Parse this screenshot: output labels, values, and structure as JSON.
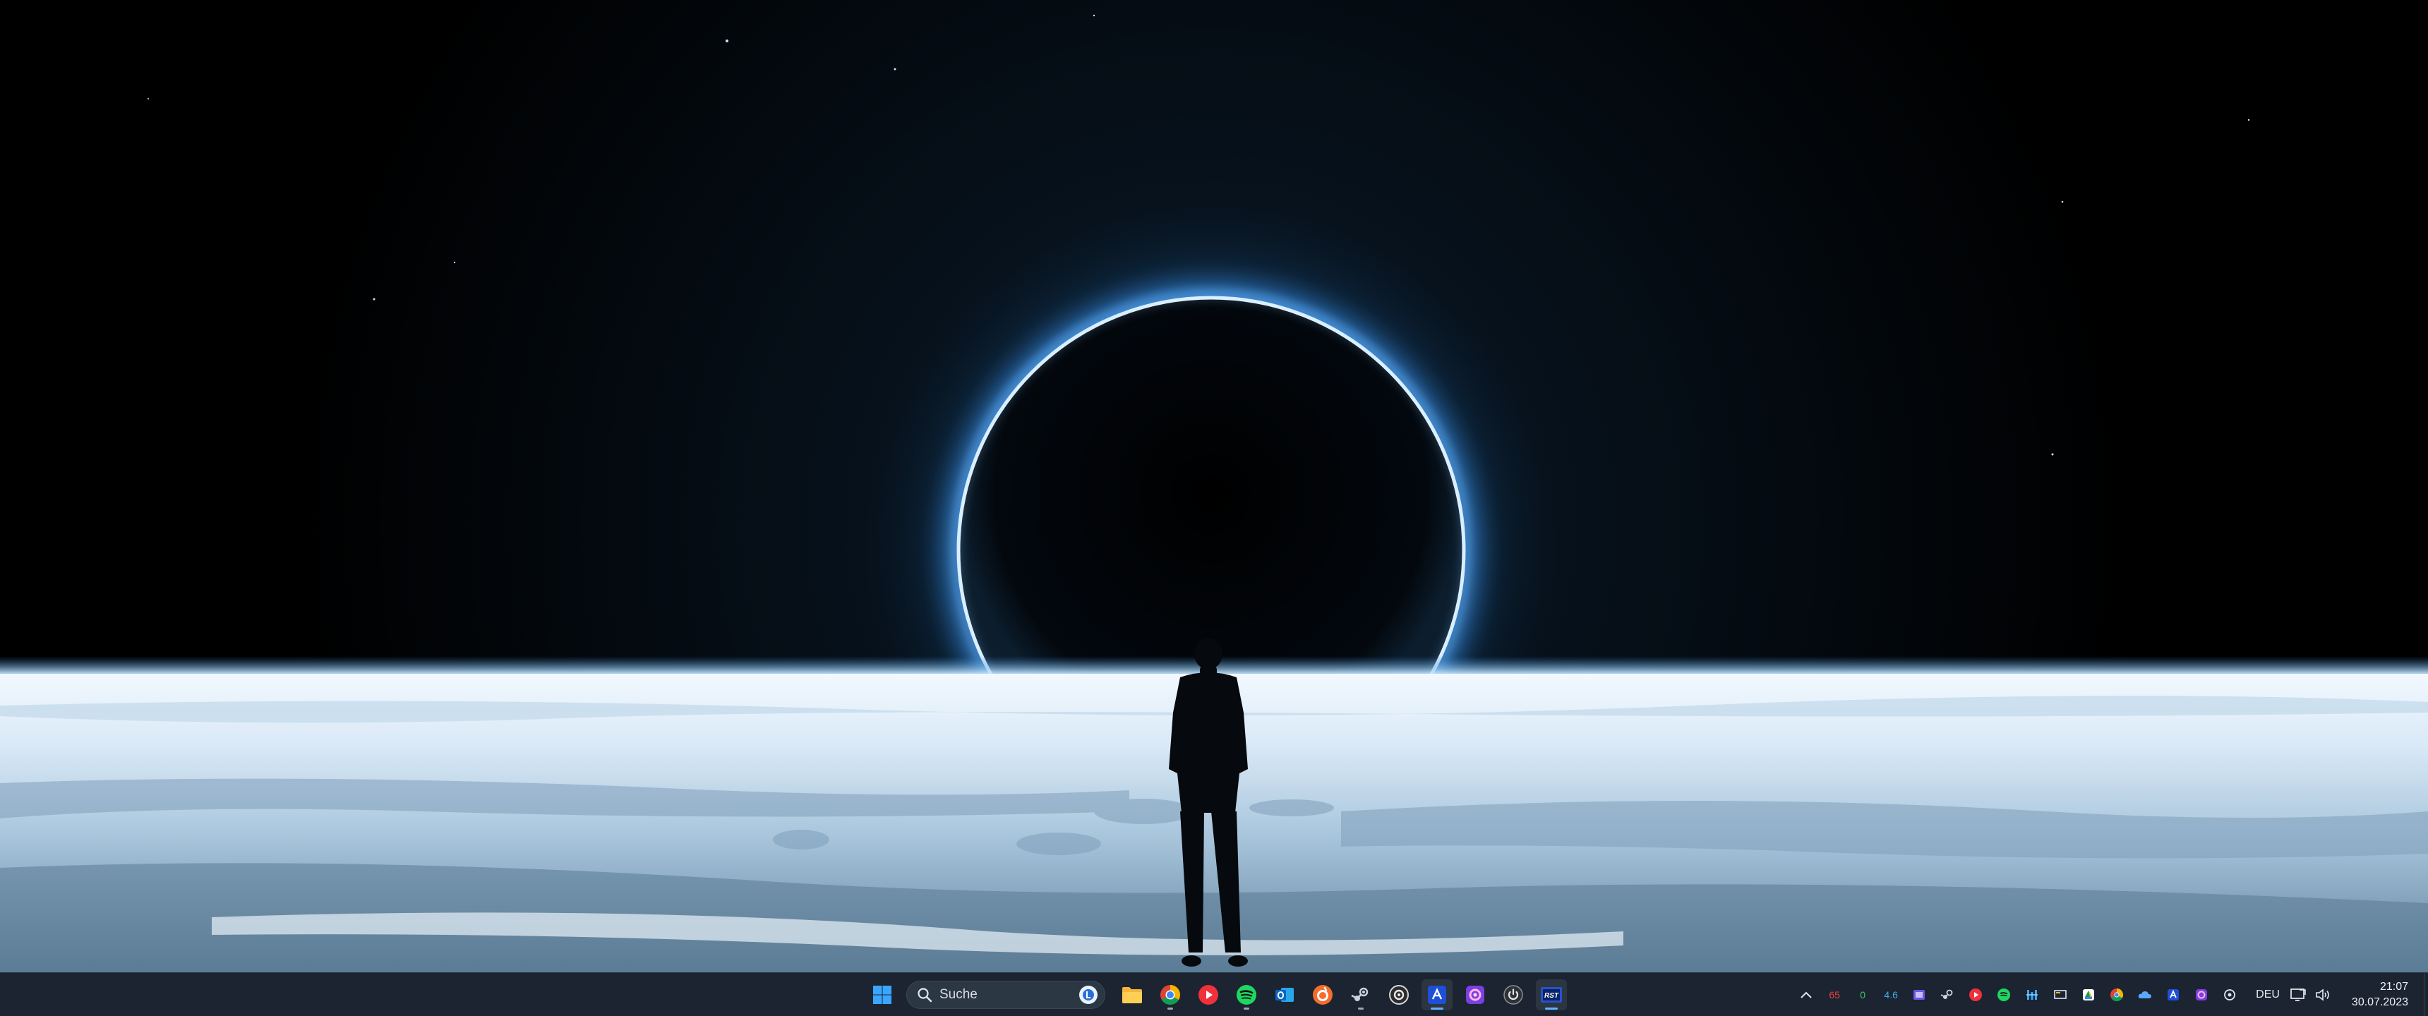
{
  "taskbar": {
    "search_placeholder": "Suche",
    "apps": [
      {
        "name": "start",
        "icon": "windows-icon",
        "running": false
      },
      {
        "name": "file-explorer",
        "icon": "folder-icon",
        "running": false
      },
      {
        "name": "chrome",
        "icon": "chrome-icon",
        "running": true
      },
      {
        "name": "youtube-music",
        "icon": "play-icon",
        "running": false
      },
      {
        "name": "spotify",
        "icon": "spotify-icon",
        "running": true
      },
      {
        "name": "outlook",
        "icon": "outlook-icon",
        "running": false
      },
      {
        "name": "origin",
        "icon": "origin-icon",
        "running": false
      },
      {
        "name": "steam",
        "icon": "steam-icon",
        "running": true
      },
      {
        "name": "gog",
        "icon": "gog-icon",
        "running": false
      },
      {
        "name": "app-blue",
        "icon": "app-blue-icon",
        "running": true
      },
      {
        "name": "app-purple",
        "icon": "app-purple-icon",
        "running": false
      },
      {
        "name": "clock-app",
        "icon": "power-icon",
        "running": false
      },
      {
        "name": "rivatuner",
        "icon": "rtss-icon",
        "running": true
      }
    ]
  },
  "tray": {
    "overflow_icon": "chevron-up-icon",
    "monitor_values": [
      "65",
      "0",
      "4.6"
    ],
    "language": "DEU",
    "time": "21:07",
    "date": "30.07.2023"
  },
  "colors": {
    "taskbar_bg": "#1b2430",
    "accent": "#5fb2ff",
    "horizon_glow": "#7fc6ff"
  }
}
